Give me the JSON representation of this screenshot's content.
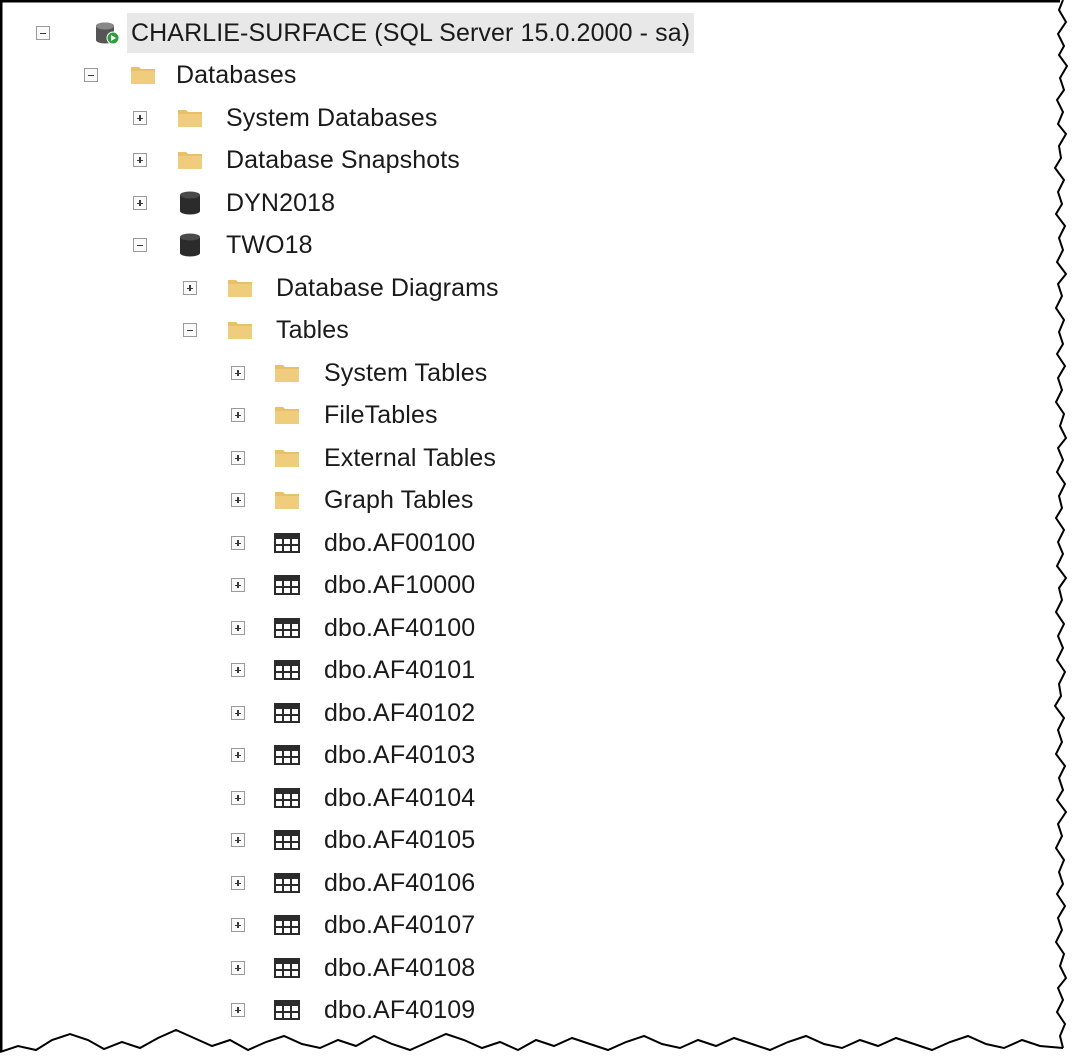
{
  "tree": {
    "server": {
      "label": "CHARLIE-SURFACE (SQL Server 15.0.2000 - sa)",
      "expanded": true,
      "icon": "server-running-icon"
    },
    "databases": {
      "label": "Databases",
      "expanded": true,
      "icon": "folder-icon"
    },
    "system_databases": {
      "label": "System Databases",
      "expanded": false,
      "icon": "folder-icon"
    },
    "database_snapshots": {
      "label": "Database Snapshots",
      "expanded": false,
      "icon": "folder-icon"
    },
    "db_dyn2018": {
      "label": "DYN2018",
      "expanded": false,
      "icon": "database-icon"
    },
    "db_two18": {
      "label": "TWO18",
      "expanded": true,
      "icon": "database-icon"
    },
    "database_diagrams": {
      "label": "Database Diagrams",
      "expanded": false,
      "icon": "folder-icon"
    },
    "tables": {
      "label": "Tables",
      "expanded": true,
      "icon": "folder-icon"
    },
    "table_folders": [
      {
        "label": "System Tables",
        "expanded": false,
        "icon": "folder-icon"
      },
      {
        "label": "FileTables",
        "expanded": false,
        "icon": "folder-icon"
      },
      {
        "label": "External Tables",
        "expanded": false,
        "icon": "folder-icon"
      },
      {
        "label": "Graph Tables",
        "expanded": false,
        "icon": "folder-icon"
      }
    ],
    "table_items": [
      {
        "label": "dbo.AF00100",
        "icon": "table-icon"
      },
      {
        "label": "dbo.AF10000",
        "icon": "table-icon"
      },
      {
        "label": "dbo.AF40100",
        "icon": "table-icon"
      },
      {
        "label": "dbo.AF40101",
        "icon": "table-icon"
      },
      {
        "label": "dbo.AF40102",
        "icon": "table-icon"
      },
      {
        "label": "dbo.AF40103",
        "icon": "table-icon"
      },
      {
        "label": "dbo.AF40104",
        "icon": "table-icon"
      },
      {
        "label": "dbo.AF40105",
        "icon": "table-icon"
      },
      {
        "label": "dbo.AF40106",
        "icon": "table-icon"
      },
      {
        "label": "dbo.AF40107",
        "icon": "table-icon"
      },
      {
        "label": "dbo.AF40108",
        "icon": "table-icon"
      },
      {
        "label": "dbo.AF40109",
        "icon": "table-icon"
      }
    ]
  },
  "colors": {
    "folder": "#e8c06a",
    "database": "#2b2b2b",
    "running_badge": "#2e9e3e",
    "selection": "#e8e8e8"
  }
}
